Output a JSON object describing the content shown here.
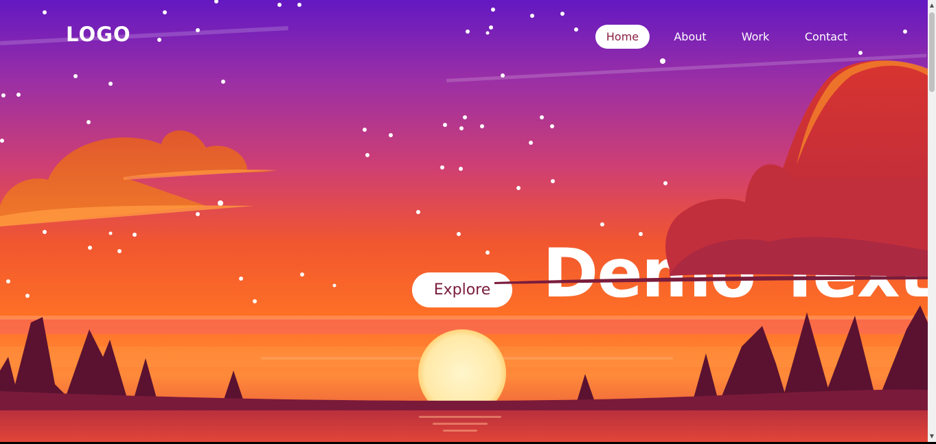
{
  "header": {
    "logo": "LOGO",
    "nav": [
      {
        "label": "Home",
        "active": true
      },
      {
        "label": "About",
        "active": false
      },
      {
        "label": "Work",
        "active": false
      },
      {
        "label": "Contact",
        "active": false
      }
    ]
  },
  "hero": {
    "cta_label": "Explore",
    "headline": "Demo Text"
  },
  "colors": {
    "sky_top": "#6a1bbf",
    "sky_mid": "#c43a86",
    "horizon": "#ff6a25",
    "sun": "#fff6cc",
    "cloud": "#d8352f",
    "trees": "#5a1230",
    "nav_active_text": "#8a1d3f"
  },
  "icons": [
    "scroll-up-arrow-icon",
    "scroll-down-arrow-icon"
  ]
}
